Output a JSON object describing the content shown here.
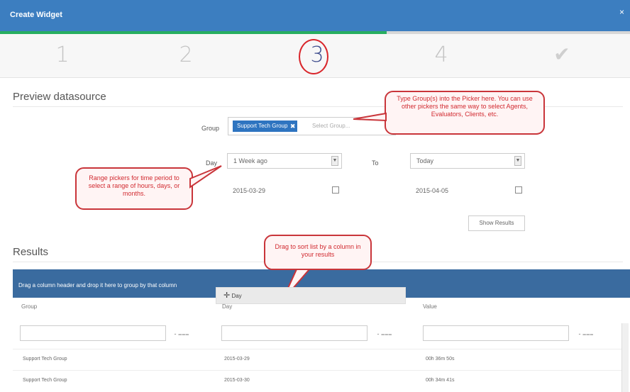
{
  "window": {
    "title": "Create Widget",
    "close": "×"
  },
  "wizard": {
    "steps": [
      "1",
      "2",
      "3",
      "4",
      "✔"
    ],
    "current": 3,
    "progress_percent": 61
  },
  "preview": {
    "heading": "Preview datasource",
    "group_label": "Group",
    "group_chip": "Support Tech Group",
    "group_placeholder": "Select Group...",
    "day_label": "Day",
    "to_label": "To",
    "from_select": "1 Week ago",
    "to_select": "Today",
    "from_date": "2015-03-29",
    "to_date": "2015-04-05",
    "show_results": "Show Results"
  },
  "callouts": {
    "group": "Type Group(s) into the Picker here. You can use other pickers the same way to select Agents, Evaluators, Clients, etc.",
    "range": "Range pickers for time period to select a range of hours, days, or months.",
    "drag": "Drag to sort list by a column in your results"
  },
  "results": {
    "heading": "Results",
    "group_bar_text": "Drag a column header and drop it here to group by that column",
    "dragging_column": "Day",
    "columns": [
      "Group",
      "Day",
      "Value"
    ],
    "rows": [
      [
        "Support Tech Group",
        "2015-03-29",
        "00h 36m 50s"
      ],
      [
        "Support Tech Group",
        "2015-03-30",
        "00h 34m 41s"
      ]
    ]
  }
}
